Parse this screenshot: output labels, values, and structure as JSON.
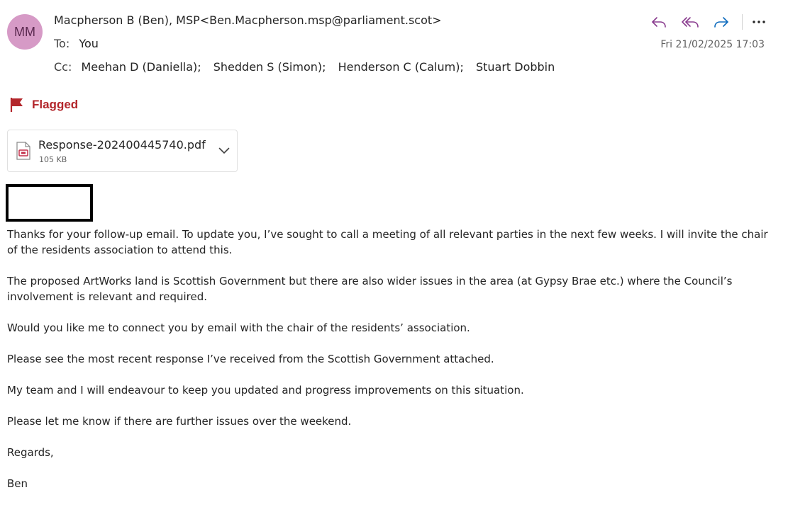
{
  "header": {
    "avatar_initials": "MM",
    "avatar_color": "#d69ac6",
    "sender": "Macpherson B (Ben), MSP<Ben.Macpherson.msp@parliament.scot>",
    "to_label": "To:",
    "to_value": "You",
    "cc_label": "Cc:",
    "cc_recipients": [
      "Meehan D (Daniella);",
      "Shedden S (Simon);",
      "Henderson C (Calum);",
      "Stuart Dobbin"
    ],
    "date": "Fri 21/02/2025 17:03"
  },
  "actions": [
    {
      "icon": "reply-icon"
    },
    {
      "icon": "reply-all-icon"
    },
    {
      "icon": "forward-icon"
    },
    {
      "icon": "more-icon"
    }
  ],
  "flag": {
    "label": "Flagged",
    "color": "#b3262b"
  },
  "attachment": {
    "name": "Response-202400445740.pdf",
    "size": "105 KB",
    "icon": "pdf-icon"
  },
  "body": {
    "paragraphs": [
      "Thanks for your follow-up email. To update you, I’ve sought to call a meeting of all relevant parties in the next few weeks. I will invite the chair of the residents association to attend this.",
      "The proposed ArtWorks land is Scottish Government but there are also wider issues in the area (at Gypsy Brae etc.) where the Council’s involvement is relevant and required.",
      "Would you like me to connect you by email with the chair of the residents’ association.",
      "Please see the most recent response I’ve received from the Scottish Government attached.",
      "My team and I will endeavour to keep you updated and progress improvements on this situation.",
      "Please let me know if there are further issues over the weekend.",
      "Regards,",
      "Ben"
    ]
  },
  "colors": {
    "accent": "#0f6cbd",
    "reply_purple": "#8a3d8f"
  }
}
